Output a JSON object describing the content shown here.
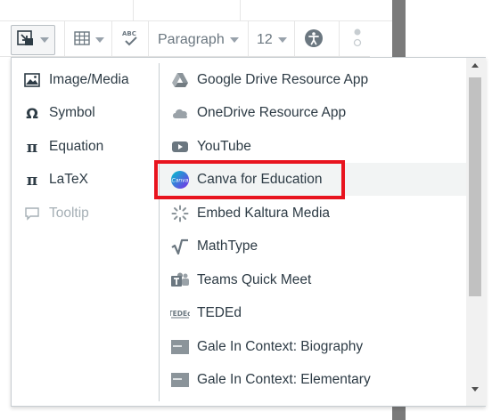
{
  "toolbar": {
    "paragraph_label": "Paragraph",
    "font_size_label": "12"
  },
  "menu": {
    "left_items": [
      {
        "label": "Image/Media",
        "icon": "image-icon",
        "disabled": false
      },
      {
        "label": "Symbol",
        "icon": "omega-icon",
        "disabled": false
      },
      {
        "label": "Equation",
        "icon": "pi-icon",
        "disabled": false
      },
      {
        "label": "LaTeX",
        "icon": "pi-icon",
        "disabled": false
      },
      {
        "label": "Tooltip",
        "icon": "speech-bubble-icon",
        "disabled": true
      }
    ],
    "right_items": [
      {
        "label": "Google Drive Resource App",
        "icon": "google-drive-icon"
      },
      {
        "label": "OneDrive Resource App",
        "icon": "onedrive-cloud-icon"
      },
      {
        "label": "YouTube",
        "icon": "youtube-icon"
      },
      {
        "label": "Canva for Education",
        "icon": "canva-icon",
        "icon_text": "Canva",
        "highlighted": true
      },
      {
        "label": "Embed Kaltura Media",
        "icon": "kaltura-icon"
      },
      {
        "label": "MathType",
        "icon": "mathtype-icon"
      },
      {
        "label": "Teams Quick Meet",
        "icon": "teams-icon"
      },
      {
        "label": "TEDEd",
        "icon": "teded-icon",
        "icon_text": "TEDEd"
      },
      {
        "label": "Gale In Context: Biography",
        "icon": "gale-icon"
      },
      {
        "label": "Gale In Context: Elementary",
        "icon": "gale-icon"
      }
    ],
    "spell_icon_text": "ABC"
  },
  "colors": {
    "highlight_border": "#e8141e",
    "canva_gradient_start": "#00c4cc",
    "canva_gradient_end": "#7d2ae8"
  }
}
